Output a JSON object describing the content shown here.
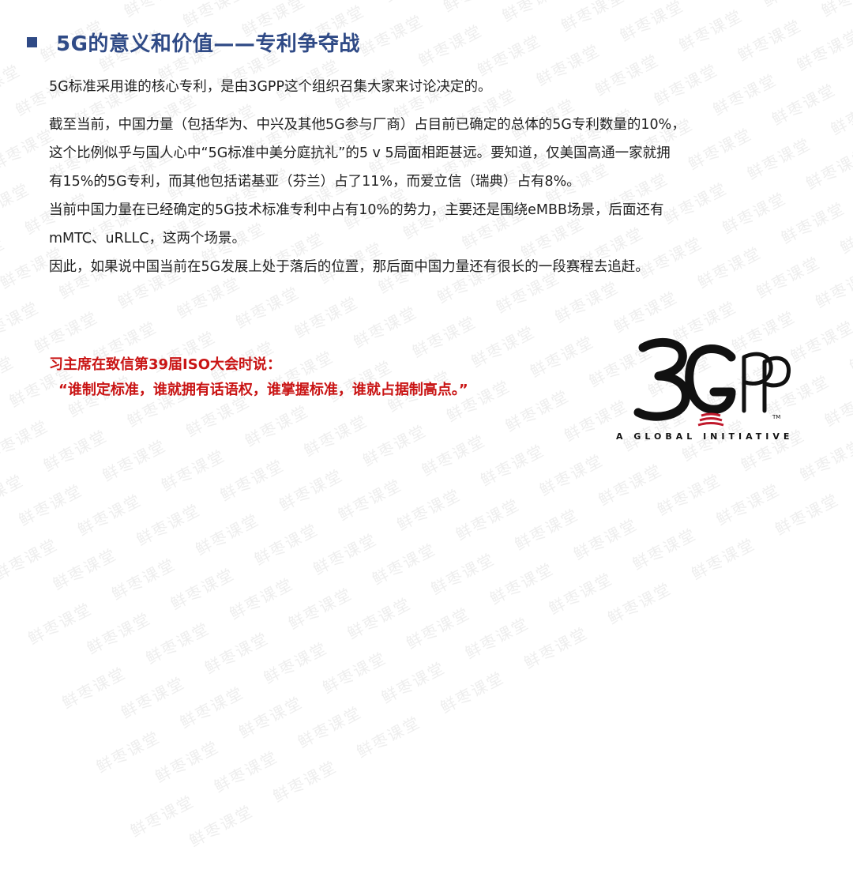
{
  "watermark": {
    "text": "鲜枣课堂"
  },
  "title": "5G的意义和价值——专利争夺战",
  "paragraphs": [
    "5G标准采用谁的核心专利，是由3GPP这个组织召集大家来讨论决定的。",
    "截至当前，中国力量（包括华为、中兴及其他5G参与厂商）占目前已确定的总体的5G专利数量的10%，",
    "这个比例似乎与国人心中“5G标准中美分庭抗礼”的5 v 5局面相距甚远。要知道，仅美国高通一家就拥",
    "有15%的5G专利，而其他包括诺基亚（芬兰）占了11%，而爱立信（瑞典）占有8%。",
    "当前中国力量在已经确定的5G技术标准专利中占有10%的势力，主要还是围绕eMBB场景，后面还有",
    "mMTC、uRLLC，这两个场景。",
    "因此，如果说中国当前在5G发展上处于落后的位置，那后面中国力量还有很长的一段赛程去追赶。"
  ],
  "quote": {
    "intro": "习主席在致信第39届ISO大会时说：",
    "text": "“谁制定标准，谁就拥有话语权，谁掌握标准，谁就占据制高点。”"
  },
  "logo": {
    "mark": "3GPP",
    "tagline": "A GLOBAL INITIATIVE",
    "tm": "TM"
  },
  "colors": {
    "title": "#2f4a86",
    "quote": "#c91414",
    "logo_accent": "#c0182b"
  }
}
